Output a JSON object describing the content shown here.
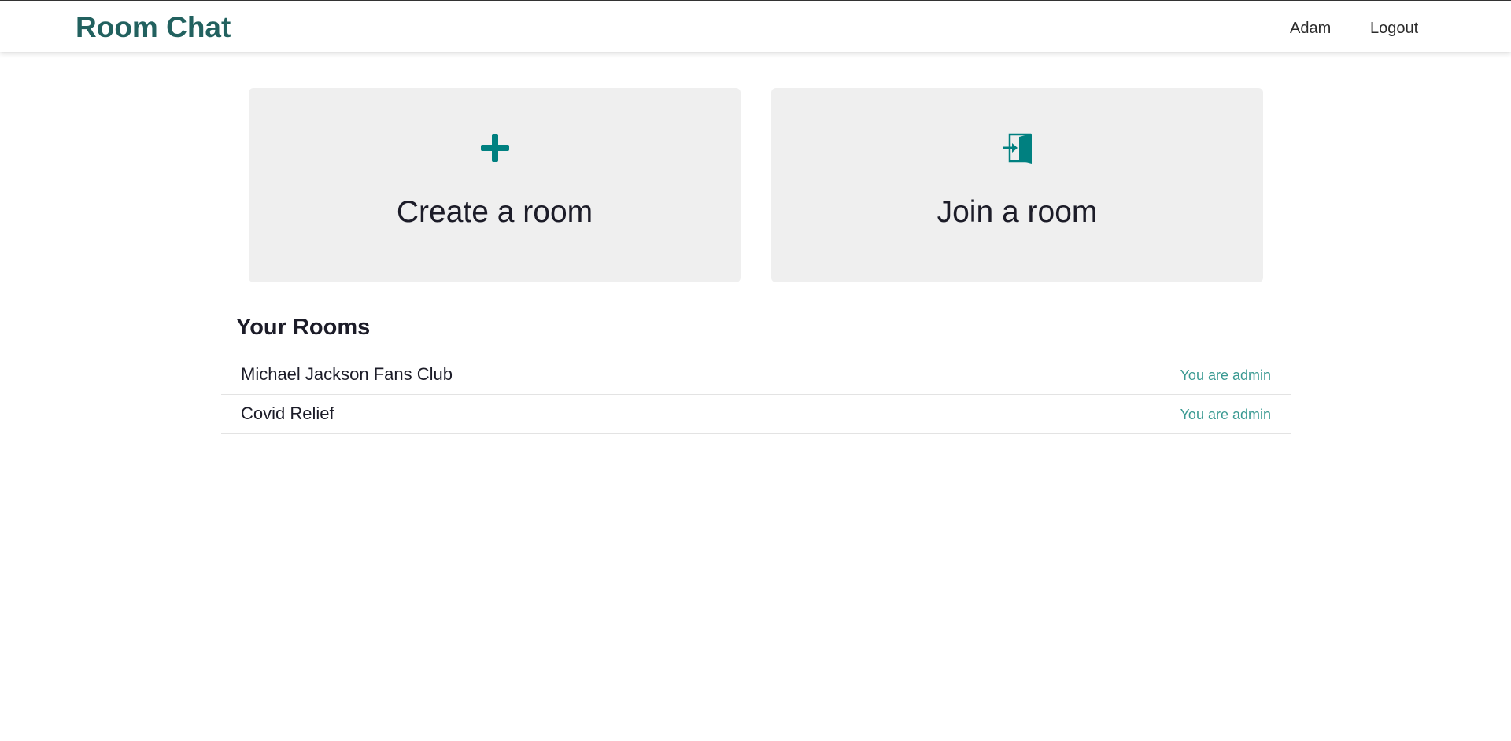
{
  "navbar": {
    "brand": "Room Chat",
    "user": "Adam",
    "logout": "Logout"
  },
  "actions": {
    "create": {
      "label": "Create a room",
      "icon": "plus-icon"
    },
    "join": {
      "label": "Join a room",
      "icon": "door-enter-icon"
    }
  },
  "rooms": {
    "title": "Your Rooms",
    "items": [
      {
        "name": "Michael Jackson Fans Club",
        "role": "You are admin"
      },
      {
        "name": "Covid Relief",
        "role": "You are admin"
      }
    ]
  },
  "colors": {
    "brand": "#22615f",
    "accent": "#008080",
    "role": "#3a9a92",
    "card_bg": "#efefef"
  }
}
